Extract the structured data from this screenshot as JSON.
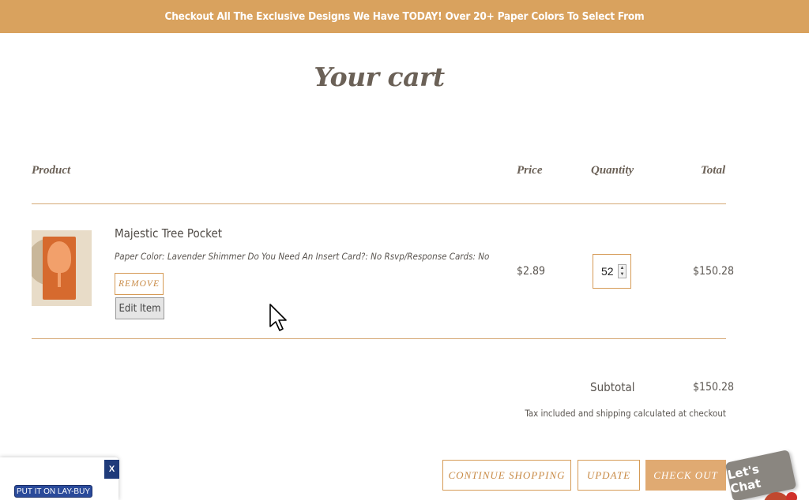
{
  "announcement": "Checkout All The Exclusive Designs We Have TODAY! Over 20+ Paper Colors To Select From",
  "page_title": "Your cart",
  "table_headers": {
    "product": "Product",
    "price": "Price",
    "quantity": "Quantity",
    "total": "Total"
  },
  "item": {
    "name": "Majestic Tree Pocket",
    "options": "Paper Color: Lavender Shimmer Do You Need An Insert Card?: No Rsvp/Response Cards: No",
    "remove_label": "REMOVE",
    "edit_label": "Edit Item",
    "price": "$2.89",
    "quantity": "52",
    "total": "$150.28"
  },
  "summary": {
    "subtotal_label": "Subtotal",
    "subtotal_value": "$150.28",
    "tax_note": "Tax included and shipping calculated at checkout"
  },
  "actions": {
    "continue_shopping": "CONTINUE SHOPPING",
    "update": "UPDATE",
    "checkout": "CHECK OUT"
  },
  "chat": {
    "label": "Let's Chat"
  },
  "laybuy": {
    "close_label": "X",
    "button_label": "PUT IT ON LAY-BUY"
  },
  "colors": {
    "accent": "#d9a25e",
    "checkout_bg": "#e0aa72",
    "laybuy_blue": "#2a4a9a"
  }
}
